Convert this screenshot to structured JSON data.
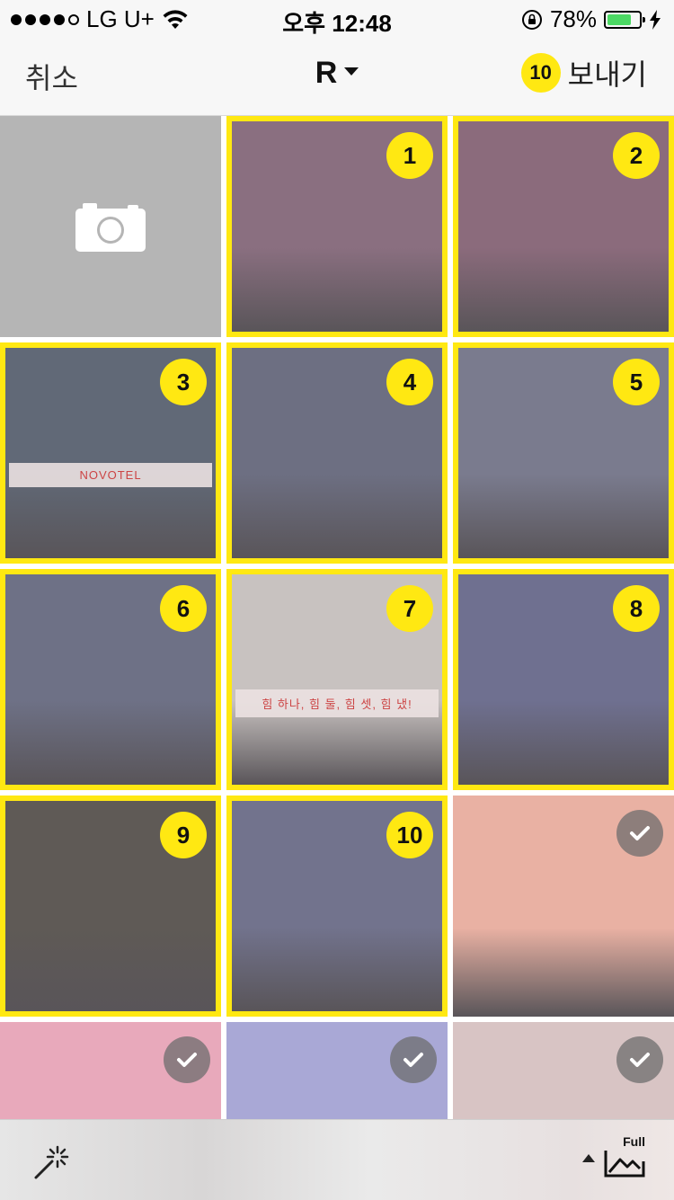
{
  "status": {
    "carrier": "LG U+",
    "time": "오후 12:48",
    "battery_percent": "78%",
    "battery_level": 0.78,
    "signal_bars_filled": 4,
    "signal_bars_total": 5
  },
  "nav": {
    "cancel_label": "취소",
    "album_label": "R",
    "send_count": "10",
    "send_label": "보내기"
  },
  "grid": {
    "camera_icon": "camera-icon",
    "cells": [
      {
        "type": "photo",
        "badge": "1",
        "tone": "#8a6f80"
      },
      {
        "type": "photo",
        "badge": "2",
        "tone": "#8b6b7c"
      },
      {
        "type": "photo",
        "badge": "3",
        "tone": "#616977",
        "caption": "NOVOTEL"
      },
      {
        "type": "photo",
        "badge": "4",
        "tone": "#6d6f82"
      },
      {
        "type": "photo",
        "badge": "5",
        "tone": "#7a7b8e"
      },
      {
        "type": "photo",
        "badge": "6",
        "tone": "#6e7186"
      },
      {
        "type": "photo",
        "badge": "7",
        "tone": "#c8c2c0",
        "caption": "힘 하나, 힘 둘, 힘 셋, 힘 냈!"
      },
      {
        "type": "photo",
        "badge": "8",
        "tone": "#6f7090"
      },
      {
        "type": "photo",
        "badge": "9",
        "tone": "#5f5a56"
      },
      {
        "type": "photo",
        "badge": "10",
        "tone": "#72738d"
      },
      {
        "type": "photo",
        "checked": true,
        "tone": "#e9b1a3"
      },
      {
        "type": "photo",
        "checked": true,
        "tone": "#e8a9bb"
      },
      {
        "type": "photo",
        "checked": true,
        "tone": "#a9a8d6"
      },
      {
        "type": "photo",
        "checked": true,
        "tone": "#d8c4c4"
      }
    ]
  },
  "toolbar": {
    "magic_icon": "magic-wand-icon",
    "full_label": "Full"
  },
  "colors": {
    "accent": "#ffe812",
    "check_bg": "#6e6e6e"
  }
}
